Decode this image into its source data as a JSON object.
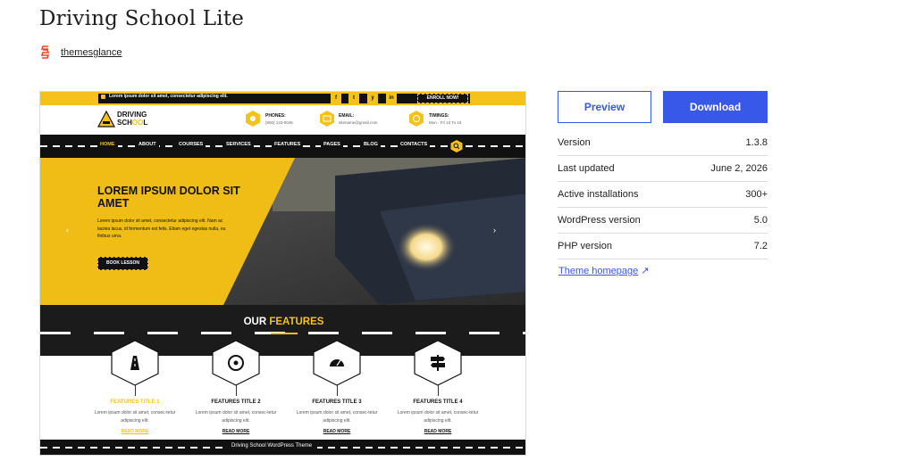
{
  "theme": {
    "title": "Driving School Lite",
    "author": "themesglance"
  },
  "preview": {
    "topbar_text": "Lorem ipsum dolor sit amet, consectetur adipiscing elit.",
    "enroll_label": "ENROLL NOW!",
    "social_icons": [
      "f",
      "t",
      "y",
      "in"
    ],
    "logo_line1": "DRIVING",
    "logo_line2a": "SCH",
    "logo_line2b": "OO",
    "logo_line2c": "L",
    "info": [
      {
        "label": "PHONES:",
        "value": "(800) 123-0045"
      },
      {
        "label": "EMAIL:",
        "value": "sitename@gmail.com"
      },
      {
        "label": "TIMINGS:",
        "value": "Mon - Fri 10 To 18"
      }
    ],
    "nav": [
      "HOME",
      "ABOUT",
      "COURSES",
      "SERVICES",
      "FEATURES",
      "PAGES",
      "BLOG",
      "CONTACTS"
    ],
    "hero_title": "LOREM IPSUM DOLOR SIT AMET",
    "hero_text": "Lorem ipsum dolor sit amet, consectetur adipiscing elit. Nam ac lacinia lacus, id fermentum est felis. Etiam eget egestas nulla, eu finibus urna.",
    "hero_button": "BOOK LESSON",
    "features_heading_a": "OUR ",
    "features_heading_b": "FEATURES",
    "features": [
      {
        "title": "FEATURES TITLE 1",
        "text": "Lorem ipsum dolor sit amet, consec-tetur adipiscing elit.",
        "read": "READ MORE"
      },
      {
        "title": "FEATURES TITLE 2",
        "text": "Lorem ipsum dolor sit amet, consec-tetur adipiscing elit.",
        "read": "READ MORE"
      },
      {
        "title": "FEATURES TITLE 3",
        "text": "Lorem ipsum dolor sit amet, consec-tetur adipiscing elit.",
        "read": "READ MORE"
      },
      {
        "title": "FEATURES TITLE 4",
        "text": "Lorem ipsum dolor sit amet, consec-tetur adipiscing elit.",
        "read": "READ MORE"
      }
    ],
    "footer_text": "Driving School WordPress Theme"
  },
  "actions": {
    "preview_label": "Preview",
    "download_label": "Download"
  },
  "meta": [
    {
      "label": "Version",
      "value": "1.3.8"
    },
    {
      "label": "Last updated",
      "value": "June 2, 2026"
    },
    {
      "label": "Active installations",
      "value": "300+"
    },
    {
      "label": "WordPress version",
      "value": "5.0"
    },
    {
      "label": "PHP version",
      "value": "7.2"
    }
  ],
  "homepage_label": "Theme homepage",
  "colors": {
    "accent": "#3858e9",
    "theme_yellow": "#f5c21b",
    "theme_dark": "#111111"
  }
}
